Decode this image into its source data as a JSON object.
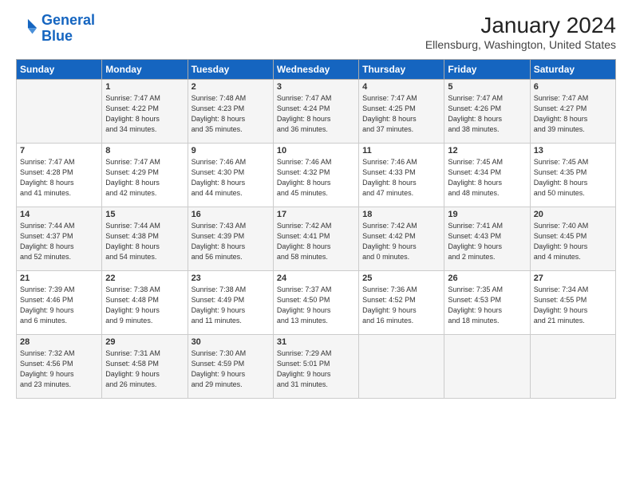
{
  "header": {
    "logo_line1": "General",
    "logo_line2": "Blue",
    "title": "January 2024",
    "location": "Ellensburg, Washington, United States"
  },
  "weekdays": [
    "Sunday",
    "Monday",
    "Tuesday",
    "Wednesday",
    "Thursday",
    "Friday",
    "Saturday"
  ],
  "weeks": [
    [
      {
        "day": "",
        "content": ""
      },
      {
        "day": "1",
        "content": "Sunrise: 7:47 AM\nSunset: 4:22 PM\nDaylight: 8 hours\nand 34 minutes."
      },
      {
        "day": "2",
        "content": "Sunrise: 7:48 AM\nSunset: 4:23 PM\nDaylight: 8 hours\nand 35 minutes."
      },
      {
        "day": "3",
        "content": "Sunrise: 7:47 AM\nSunset: 4:24 PM\nDaylight: 8 hours\nand 36 minutes."
      },
      {
        "day": "4",
        "content": "Sunrise: 7:47 AM\nSunset: 4:25 PM\nDaylight: 8 hours\nand 37 minutes."
      },
      {
        "day": "5",
        "content": "Sunrise: 7:47 AM\nSunset: 4:26 PM\nDaylight: 8 hours\nand 38 minutes."
      },
      {
        "day": "6",
        "content": "Sunrise: 7:47 AM\nSunset: 4:27 PM\nDaylight: 8 hours\nand 39 minutes."
      }
    ],
    [
      {
        "day": "7",
        "content": "Sunrise: 7:47 AM\nSunset: 4:28 PM\nDaylight: 8 hours\nand 41 minutes."
      },
      {
        "day": "8",
        "content": "Sunrise: 7:47 AM\nSunset: 4:29 PM\nDaylight: 8 hours\nand 42 minutes."
      },
      {
        "day": "9",
        "content": "Sunrise: 7:46 AM\nSunset: 4:30 PM\nDaylight: 8 hours\nand 44 minutes."
      },
      {
        "day": "10",
        "content": "Sunrise: 7:46 AM\nSunset: 4:32 PM\nDaylight: 8 hours\nand 45 minutes."
      },
      {
        "day": "11",
        "content": "Sunrise: 7:46 AM\nSunset: 4:33 PM\nDaylight: 8 hours\nand 47 minutes."
      },
      {
        "day": "12",
        "content": "Sunrise: 7:45 AM\nSunset: 4:34 PM\nDaylight: 8 hours\nand 48 minutes."
      },
      {
        "day": "13",
        "content": "Sunrise: 7:45 AM\nSunset: 4:35 PM\nDaylight: 8 hours\nand 50 minutes."
      }
    ],
    [
      {
        "day": "14",
        "content": "Sunrise: 7:44 AM\nSunset: 4:37 PM\nDaylight: 8 hours\nand 52 minutes."
      },
      {
        "day": "15",
        "content": "Sunrise: 7:44 AM\nSunset: 4:38 PM\nDaylight: 8 hours\nand 54 minutes."
      },
      {
        "day": "16",
        "content": "Sunrise: 7:43 AM\nSunset: 4:39 PM\nDaylight: 8 hours\nand 56 minutes."
      },
      {
        "day": "17",
        "content": "Sunrise: 7:42 AM\nSunset: 4:41 PM\nDaylight: 8 hours\nand 58 minutes."
      },
      {
        "day": "18",
        "content": "Sunrise: 7:42 AM\nSunset: 4:42 PM\nDaylight: 9 hours\nand 0 minutes."
      },
      {
        "day": "19",
        "content": "Sunrise: 7:41 AM\nSunset: 4:43 PM\nDaylight: 9 hours\nand 2 minutes."
      },
      {
        "day": "20",
        "content": "Sunrise: 7:40 AM\nSunset: 4:45 PM\nDaylight: 9 hours\nand 4 minutes."
      }
    ],
    [
      {
        "day": "21",
        "content": "Sunrise: 7:39 AM\nSunset: 4:46 PM\nDaylight: 9 hours\nand 6 minutes."
      },
      {
        "day": "22",
        "content": "Sunrise: 7:38 AM\nSunset: 4:48 PM\nDaylight: 9 hours\nand 9 minutes."
      },
      {
        "day": "23",
        "content": "Sunrise: 7:38 AM\nSunset: 4:49 PM\nDaylight: 9 hours\nand 11 minutes."
      },
      {
        "day": "24",
        "content": "Sunrise: 7:37 AM\nSunset: 4:50 PM\nDaylight: 9 hours\nand 13 minutes."
      },
      {
        "day": "25",
        "content": "Sunrise: 7:36 AM\nSunset: 4:52 PM\nDaylight: 9 hours\nand 16 minutes."
      },
      {
        "day": "26",
        "content": "Sunrise: 7:35 AM\nSunset: 4:53 PM\nDaylight: 9 hours\nand 18 minutes."
      },
      {
        "day": "27",
        "content": "Sunrise: 7:34 AM\nSunset: 4:55 PM\nDaylight: 9 hours\nand 21 minutes."
      }
    ],
    [
      {
        "day": "28",
        "content": "Sunrise: 7:32 AM\nSunset: 4:56 PM\nDaylight: 9 hours\nand 23 minutes."
      },
      {
        "day": "29",
        "content": "Sunrise: 7:31 AM\nSunset: 4:58 PM\nDaylight: 9 hours\nand 26 minutes."
      },
      {
        "day": "30",
        "content": "Sunrise: 7:30 AM\nSunset: 4:59 PM\nDaylight: 9 hours\nand 29 minutes."
      },
      {
        "day": "31",
        "content": "Sunrise: 7:29 AM\nSunset: 5:01 PM\nDaylight: 9 hours\nand 31 minutes."
      },
      {
        "day": "",
        "content": ""
      },
      {
        "day": "",
        "content": ""
      },
      {
        "day": "",
        "content": ""
      }
    ]
  ]
}
